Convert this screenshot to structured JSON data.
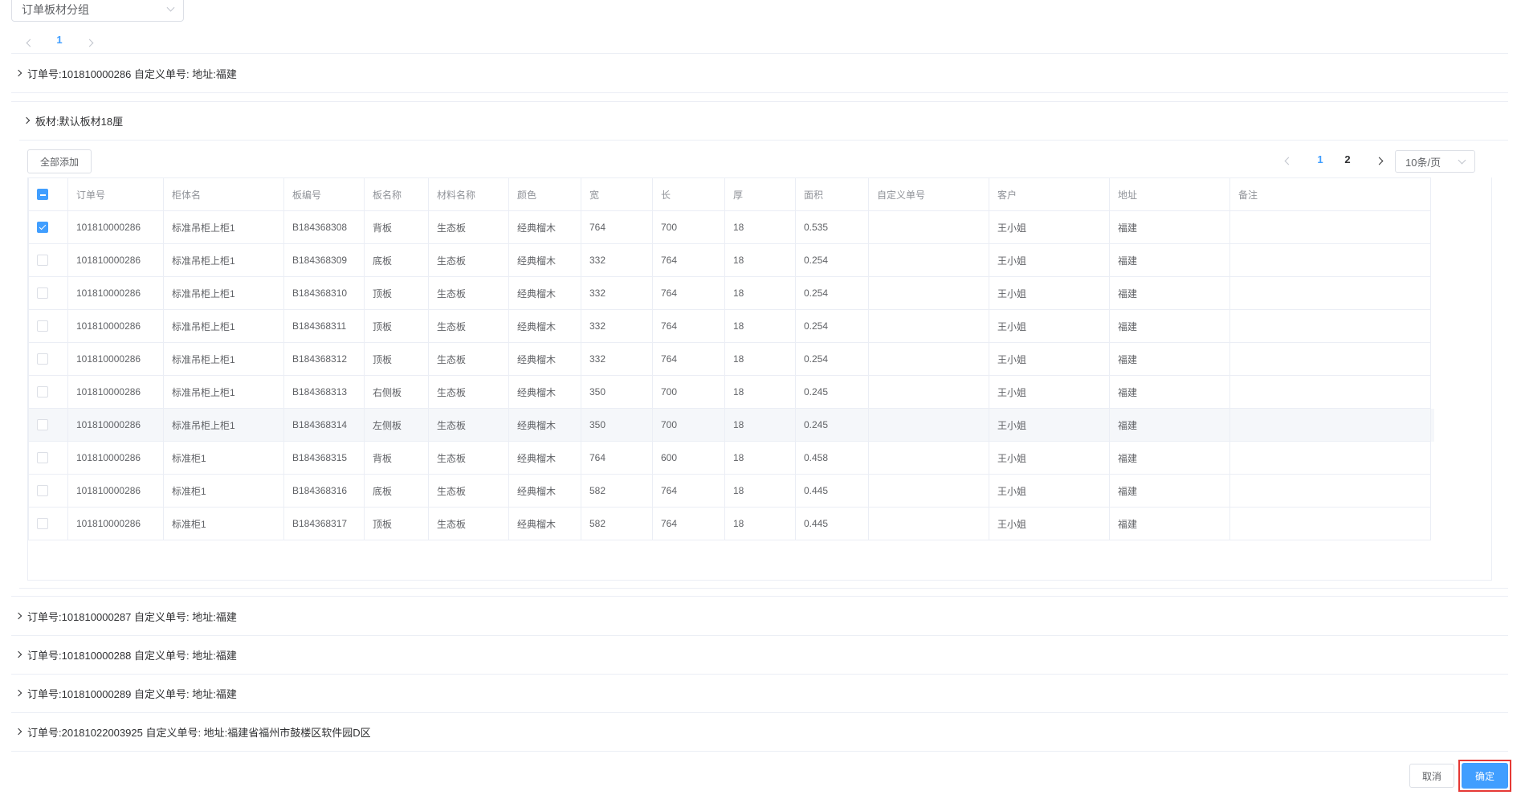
{
  "group_select": {
    "value": "订单板材分组"
  },
  "top_pager": {
    "current": "1"
  },
  "orders": [
    {
      "label": "订单号:101810000286 自定义单号: 地址:福建"
    },
    {
      "label": "订单号:101810000287 自定义单号: 地址:福建"
    },
    {
      "label": "订单号:101810000288 自定义单号: 地址:福建"
    },
    {
      "label": "订单号:101810000289 自定义单号: 地址:福建"
    },
    {
      "label": "订单号:20181022003925 自定义单号: 地址:福建省福州市鼓楼区软件园D区"
    }
  ],
  "material_group": {
    "label": "板材:默认板材18厘"
  },
  "add_all_button": "全部添加",
  "table_pager": {
    "pages": [
      "1",
      "2"
    ],
    "current": "1",
    "page_size": "10条/页"
  },
  "table": {
    "columns": [
      "订单号",
      "柜体名",
      "板编号",
      "板名称",
      "材料名称",
      "颜色",
      "宽",
      "长",
      "厚",
      "面积",
      "自定义单号",
      "客户",
      "地址",
      "备注"
    ],
    "rows": [
      {
        "checked": true,
        "cells": [
          "101810000286",
          "标准吊柜上柜1",
          "B184368308",
          "背板",
          "生态板",
          "经典榴木",
          "764",
          "700",
          "18",
          "0.535",
          "",
          "王小姐",
          "福建",
          ""
        ]
      },
      {
        "checked": false,
        "cells": [
          "101810000286",
          "标准吊柜上柜1",
          "B184368309",
          "底板",
          "生态板",
          "经典榴木",
          "332",
          "764",
          "18",
          "0.254",
          "",
          "王小姐",
          "福建",
          ""
        ]
      },
      {
        "checked": false,
        "cells": [
          "101810000286",
          "标准吊柜上柜1",
          "B184368310",
          "顶板",
          "生态板",
          "经典榴木",
          "332",
          "764",
          "18",
          "0.254",
          "",
          "王小姐",
          "福建",
          ""
        ]
      },
      {
        "checked": false,
        "cells": [
          "101810000286",
          "标准吊柜上柜1",
          "B184368311",
          "顶板",
          "生态板",
          "经典榴木",
          "332",
          "764",
          "18",
          "0.254",
          "",
          "王小姐",
          "福建",
          ""
        ]
      },
      {
        "checked": false,
        "cells": [
          "101810000286",
          "标准吊柜上柜1",
          "B184368312",
          "顶板",
          "生态板",
          "经典榴木",
          "332",
          "764",
          "18",
          "0.254",
          "",
          "王小姐",
          "福建",
          ""
        ]
      },
      {
        "checked": false,
        "cells": [
          "101810000286",
          "标准吊柜上柜1",
          "B184368313",
          "右侧板",
          "生态板",
          "经典榴木",
          "350",
          "700",
          "18",
          "0.245",
          "",
          "王小姐",
          "福建",
          ""
        ]
      },
      {
        "checked": false,
        "cells": [
          "101810000286",
          "标准吊柜上柜1",
          "B184368314",
          "左侧板",
          "生态板",
          "经典榴木",
          "350",
          "700",
          "18",
          "0.245",
          "",
          "王小姐",
          "福建",
          ""
        ]
      },
      {
        "checked": false,
        "cells": [
          "101810000286",
          "标准柜1",
          "B184368315",
          "背板",
          "生态板",
          "经典榴木",
          "764",
          "600",
          "18",
          "0.458",
          "",
          "王小姐",
          "福建",
          ""
        ]
      },
      {
        "checked": false,
        "cells": [
          "101810000286",
          "标准柜1",
          "B184368316",
          "底板",
          "生态板",
          "经典榴木",
          "582",
          "764",
          "18",
          "0.445",
          "",
          "王小姐",
          "福建",
          ""
        ]
      },
      {
        "checked": false,
        "cells": [
          "101810000286",
          "标准柜1",
          "B184368317",
          "顶板",
          "生态板",
          "经典榴木",
          "582",
          "764",
          "18",
          "0.445",
          "",
          "王小姐",
          "福建",
          ""
        ]
      }
    ]
  },
  "footer": {
    "cancel": "取消",
    "confirm": "确定"
  },
  "colors": {
    "primary": "#409eff",
    "highlight_border": "#e53935",
    "border": "#ebeef5"
  }
}
